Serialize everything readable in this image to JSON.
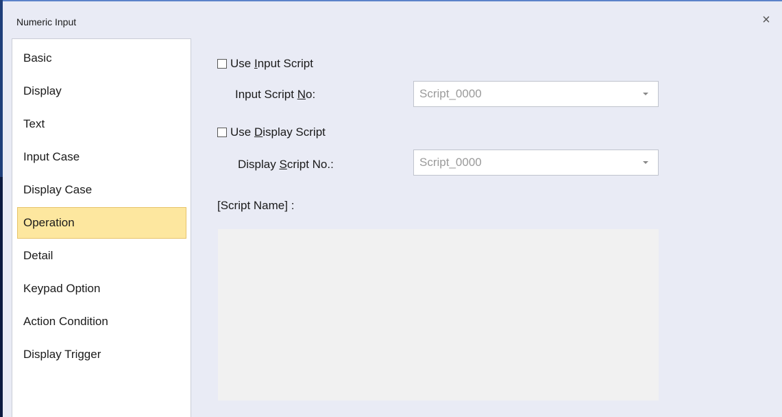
{
  "window": {
    "title": "Numeric Input",
    "close_glyph": "×"
  },
  "sidebar": {
    "items": [
      {
        "label": "Basic"
      },
      {
        "label": "Display"
      },
      {
        "label": "Text"
      },
      {
        "label": "Input Case"
      },
      {
        "label": "Display Case"
      },
      {
        "label": "Operation",
        "selected": true
      },
      {
        "label": "Detail"
      },
      {
        "label": "Keypad Option"
      },
      {
        "label": "Action Condition"
      },
      {
        "label": "Display Trigger"
      }
    ]
  },
  "operation": {
    "use_input_script": {
      "pre": "Use ",
      "accel": "I",
      "post": "nput Script",
      "checked": false
    },
    "input_script_no": {
      "pre": "Input Script ",
      "accel": "N",
      "post": "o:"
    },
    "input_script_combo": {
      "value": "Script_0000"
    },
    "use_display_script": {
      "pre": "Use ",
      "accel": "D",
      "post": "isplay Script",
      "checked": false
    },
    "display_script_no": {
      "pre": "Display ",
      "accel": "S",
      "post": "cript No.:"
    },
    "display_script_combo": {
      "value": "Script_0000"
    },
    "script_name_label": "[Script Name] :"
  },
  "colors": {
    "selected_bg": "#fde79f",
    "window_bg": "#e9ebf5",
    "accent_border": "#1f3f7a"
  }
}
